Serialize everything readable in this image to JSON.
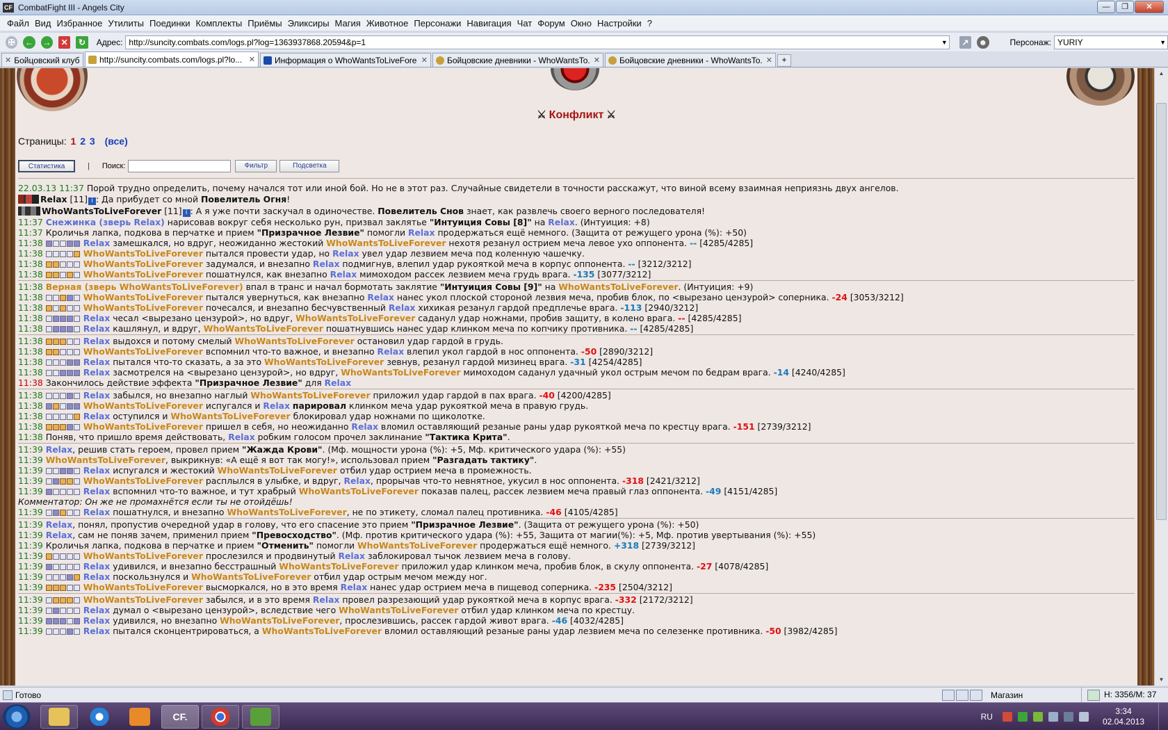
{
  "window": {
    "title": "CombatFight III - Angels City",
    "icon_text": "CF"
  },
  "menu": [
    "Файл",
    "Вид",
    "Избранное",
    "Утилиты",
    "Поединки",
    "Комплекты",
    "Приёмы",
    "Эликсиры",
    "Магия",
    "Животное",
    "Персонажи",
    "Навигация",
    "Чат",
    "Форум",
    "Окно",
    "Настройки",
    "?"
  ],
  "address": {
    "label": "Адрес:",
    "value": "http://suncity.combats.com/logs.pl?log=1363937868.20594&p=1",
    "persona_label": "Персонаж:",
    "persona_value": "YURIY"
  },
  "tabs": [
    {
      "label": "Бойцовский клуб",
      "icon_color": "#c8a03a"
    },
    {
      "label": "http://suncity.combats.com/logs.pl?lo...",
      "icon_color": "#c8a03a",
      "active": true
    },
    {
      "label": "Информация о WhoWantsToLiveFore...",
      "icon_color": "#1a4aa8"
    },
    {
      "label": "Бойцовские дневники - WhoWantsTo...",
      "icon_color": "#c8a03a"
    },
    {
      "label": "Бойцовские дневники - WhoWantsTo...",
      "icon_color": "#c8a03a"
    }
  ],
  "page": {
    "title": "Конфликт",
    "pages_label": "Страницы:",
    "pages": [
      "1",
      "2",
      "3"
    ],
    "pages_all": "(все)",
    "btn_stats": "Статистика",
    "separator": "|",
    "search_label": "Поиск:",
    "search_value": "",
    "btn_filter": "Фильтр",
    "btn_highlight": "Подсветка"
  },
  "log": {
    "intro_time": "22.03.13 11:37",
    "intro": "Порой трудно определить, почему начался тот или иной бой. Но не в этот раз. Случайные свидетели в точности расскажут, что виной всему взаимная неприязнь двух ангелов.",
    "relax_level": "[11]",
    "relax_says": ": Да прибудет со мной ",
    "relax_says_b": "Повелитель Огня",
    "relax_says_end": "!",
    "who_level": "[11]",
    "who_says": ": А я уже почти заскучал в одиночестве. ",
    "who_says_b": "Повелитель Снов",
    "who_says_end": " знает, как развлечь своего верного последователя!",
    "p1": "Relax",
    "p2": "WhoWantsToLiveForever",
    "pet1": "Снежинка (зверь Relax)",
    "pet2": "Верная (зверь WhoWantsToLiveForever)",
    "lines": {
      "l1_t": "11:37",
      "l1_a": " нарисовав вокруг себя несколько рун, призвал заклятье ",
      "l1_b": "\"Интуиция Совы [8]\"",
      "l1_c": " на ",
      "l1_d": ". (Интуиция: +8)",
      "l2_t": "11:37",
      "l2_a": "Кроличья лапка, подкова в перчатке и прием ",
      "l2_b": "\"Призрачное Лезвие\"",
      "l2_c": " помогли ",
      "l2_d": " продержаться ещё немного. (Защита от режущего урона (%): +50)",
      "l3_t": "11:38",
      "l3_a": " замешкался, но вдруг, неожиданно жестокий ",
      "l3_b": " нехотя резанул острием меча левое ухо оппонента. ",
      "l3_d": "--",
      "l3_h": " [4285/4285]",
      "l4_t": "11:38",
      "l4_a": " пытался провести удар, но ",
      "l4_b": " увел удар лезвием меча под коленную чашечку.",
      "l5_t": "11:38",
      "l5_a": " задумался, и внезапно ",
      "l5_b": " подмигнув, влепил удар рукояткой меча в корпус оппонента. ",
      "l5_d": "--",
      "l5_h": " [3212/3212]",
      "l6_t": "11:38",
      "l6_a": " пошатнулся, как внезапно ",
      "l6_b": " мимоходом рассек лезвием меча грудь врага. ",
      "l6_d": "-135",
      "l6_h": " [3077/3212]",
      "l7_t": "11:38",
      "l7_a": " впал в транс и начал бормотать заклятие ",
      "l7_b": "\"Интуиция Совы [9]\"",
      "l7_c": " на ",
      "l7_d": ". (Интуиция: +9)",
      "l8_t": "11:38",
      "l8_a": " пытался увернуться, как внезапно ",
      "l8_b": " нанес укол плоской стороной лезвия меча, пробив блок, по <вырезано цензурой> соперника. ",
      "l8_d": "-24",
      "l8_h": " [3053/3212]",
      "l9_t": "11:38",
      "l9_a": " почесался, и внезапно бесчувственный ",
      "l9_b": " хихикая резанул гардой предплечье врага. ",
      "l9_d": "-113",
      "l9_h": " [2940/3212]",
      "l10_t": "11:38",
      "l10_a": " чесал <вырезано цензурой>, но вдруг, ",
      "l10_b": " саданул удар ножнами, пробив защиту, в колено врага. ",
      "l10_d": "--",
      "l10_h": " [4285/4285]",
      "l11_t": "11:38",
      "l11_a": " кашлянул, и вдруг, ",
      "l11_b": " пошатнувшись нанес удар клинком меча по копчику противника. ",
      "l11_d": "--",
      "l11_h": " [4285/4285]",
      "l12_t": "11:38",
      "l12_a": " выдохся и потому смелый ",
      "l12_b": " остановил удар гардой в грудь.",
      "l13_t": "11:38",
      "l13_a": " вспомнил что-то важное, и внезапно ",
      "l13_b": " влепил укол гардой в нос оппонента. ",
      "l13_d": "-50",
      "l13_h": " [2890/3212]",
      "l14_t": "11:38",
      "l14_a": " пытался что-то сказать, а за это ",
      "l14_b": " зевнув, резанул гардой мизинец врага. ",
      "l14_d": "-31",
      "l14_h": " [4254/4285]",
      "l15_t": "11:38",
      "l15_a": " засмотрелся на <вырезано цензурой>, но вдруг, ",
      "l15_b": " мимоходом саданул удачный укол острым мечом по бедрам врага. ",
      "l15_d": "-14",
      "l15_h": " [4240/4285]",
      "l16_t": "11:38",
      "l16_a": "Закончилось действие эффекта ",
      "l16_b": "\"Призрачное Лезвие\"",
      "l16_c": " для ",
      "l17_t": "11:38",
      "l17_a": " забылся, но внезапно наглый ",
      "l17_b": " приложил удар гардой в пах врага. ",
      "l17_d": "-40",
      "l17_h": " [4200/4285]",
      "l18_t": "11:38",
      "l18_a": " испугался и ",
      "l18_b": "парировал",
      "l18_c": " клинком меча удар рукояткой меча в правую грудь.",
      "l19_t": "11:38",
      "l19_a": " оступился и ",
      "l19_b": " блокировал удар ножнами по щиколотке.",
      "l20_t": "11:38",
      "l20_a": " пришел в себя, но неожиданно ",
      "l20_b": " вломил оставляющий резаные раны удар рукояткой меча по крестцу врага. ",
      "l20_d": "-151",
      "l20_h": " [2739/3212]",
      "l21_t": "11:38",
      "l21_a": "Поняв, что пришло время действовать, ",
      "l21_b": " робким голосом прочел заклинание ",
      "l21_c": "\"Тактика Крита\"",
      "l21_d": ".",
      "l22_t": "11:39",
      "l22_a": ", решив стать героем, провел прием ",
      "l22_b": "\"Жажда Крови\"",
      "l22_c": ". (Мф. мощности урона (%): +5, Мф. критического удара (%): +55)",
      "l23_t": "11:39",
      "l23_a": ", выкрикнув: «А ещё я вот так могу!», использовал прием ",
      "l23_b": "\"Разгадать тактику\"",
      "l23_c": ".",
      "l24_t": "11:39",
      "l24_a": " испугался и жестокий ",
      "l24_b": " отбил удар острием меча в промежность.",
      "l25_t": "11:39",
      "l25_a": " расплылся в улыбке, и вдруг, ",
      "l25_b": ", прорычав что-то невнятное, укусил в нос оппонента. ",
      "l25_d": "-318",
      "l25_h": " [2421/3212]",
      "l26_t": "11:39",
      "l26_a": " вспомнил что-то важное, и тут храбрый ",
      "l26_b": " показав палец, рассек лезвием меча правый глаз оппонента. ",
      "l26_d": "-49",
      "l26_h": " [4151/4285]",
      "l27": "Комментатор: Он же не промахнётся если ты не отойдёшь!",
      "l28_t": "11:39",
      "l28_a": " пошатнулся, и внезапно ",
      "l28_b": ", не по этикету, сломал палец противника. ",
      "l28_d": "-46",
      "l28_h": " [4105/4285]",
      "l29_t": "11:39",
      "l29_a": ", понял, пропустив очередной удар в голову, что его спасение это прием ",
      "l29_b": "\"Призрачное Лезвие\"",
      "l29_c": ". (Защита от режущего урона (%): +50)",
      "l30_t": "11:39",
      "l30_a": ", сам не поняв зачем, применил прием ",
      "l30_b": "\"Превосходство\"",
      "l30_c": ". (Мф. против критического удара (%): +55, Защита от магии(%): +5, Мф. против увертывания (%): +55)",
      "l31_t": "11:39",
      "l31_a": "Кроличья лапка, подкова в перчатке и прием ",
      "l31_b": "\"Отменить\"",
      "l31_c": " помогли ",
      "l31_d": " продержаться ещё немного. ",
      "l31_e": "+318",
      "l31_h": " [2739/3212]",
      "l32_t": "11:39",
      "l32_a": " прослезился и продвинутый ",
      "l32_b": " заблокировал тычок лезвием меча в голову.",
      "l33_t": "11:39",
      "l33_a": " удивился, и внезапно бесстрашный ",
      "l33_b": " приложил удар клинком меча, пробив блок, в скулу оппонента. ",
      "l33_d": "-27",
      "l33_h": " [4078/4285]",
      "l34_t": "11:39",
      "l34_a": " поскользнулся и ",
      "l34_b": " отбил удар острым мечом между ног.",
      "l35_t": "11:39",
      "l35_a": " высморкался, но в это время ",
      "l35_b": " нанес удар острием меча в пищевод соперника. ",
      "l35_d": "-235",
      "l35_h": " [2504/3212]",
      "l36_t": "11:39",
      "l36_a": " забылся, и в это время ",
      "l36_b": " провел разрезающий удар рукояткой меча в корпус врага. ",
      "l36_d": "-332",
      "l36_h": " [2172/3212]",
      "l37_t": "11:39",
      "l37_a": " думал о <вырезано цензурой>, вследствие чего ",
      "l37_b": " отбил удар клинком меча по крестцу.",
      "l38_t": "11:39",
      "l38_a": " удивился, но внезапно ",
      "l38_b": ", прослезившись, рассек гардой живот врага. ",
      "l38_d": "-46",
      "l38_h": " [4032/4285]",
      "l39_t": "11:39",
      "l39_a": " пытался сконцентрироваться, а ",
      "l39_b": " вломил оставляющий резаные раны удар лезвием меча по селезенке противника. ",
      "l39_d": "-50",
      "l39_h": " [3982/4285]"
    }
  },
  "status": {
    "text": "Готово",
    "shop": "Магазин",
    "hp": "Н: 3356/М: 37"
  },
  "taskbar": {
    "lang": "RU",
    "time": "3:34",
    "date": "02.04.2013",
    "cf_label": "CF."
  }
}
